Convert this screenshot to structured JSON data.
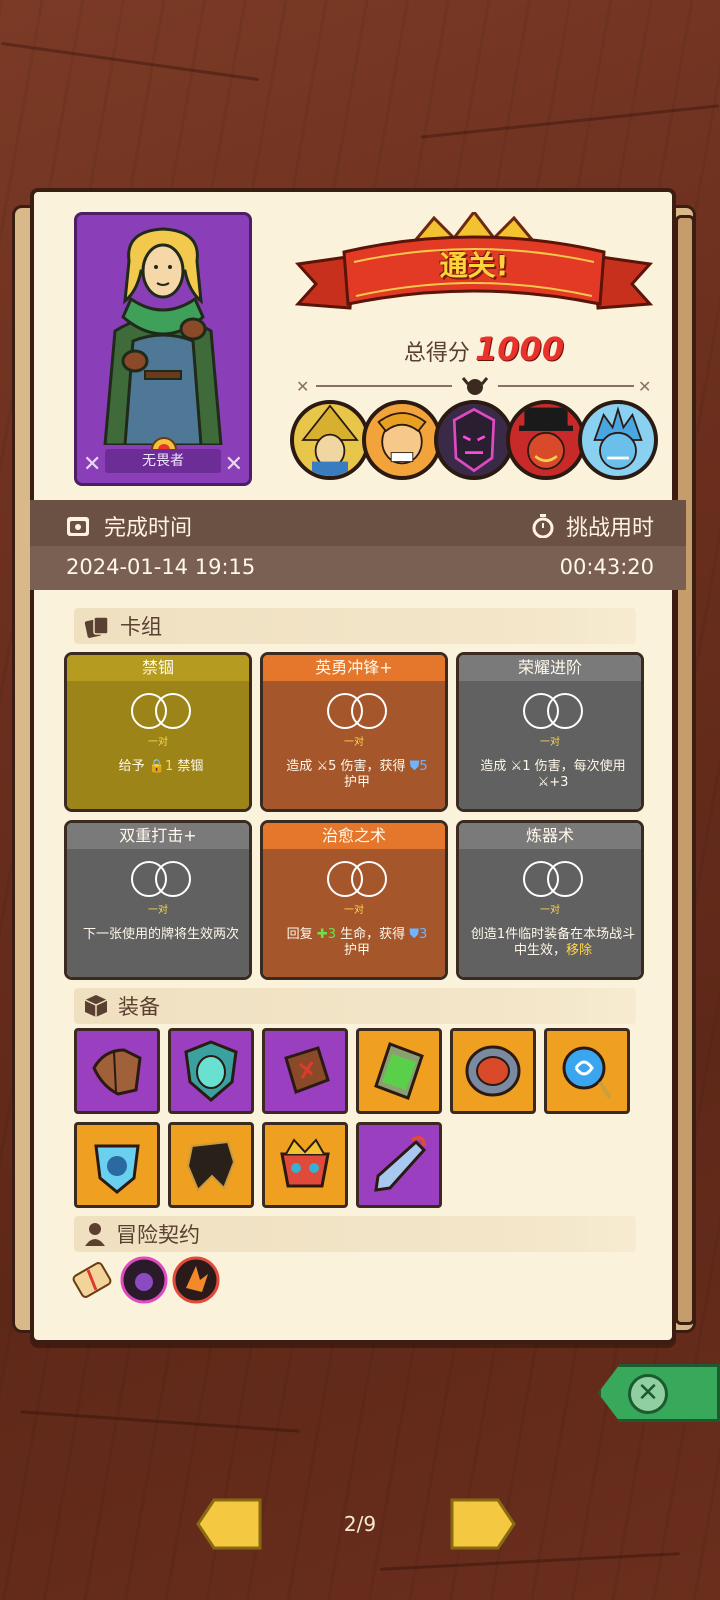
{
  "hero": {
    "name": "无畏者"
  },
  "result": {
    "banner": "通关!",
    "score_label": "总得分",
    "score_value": "1000"
  },
  "bosses": [
    "boss-1",
    "boss-2",
    "boss-3",
    "boss-4",
    "boss-5"
  ],
  "stats": {
    "complete_label": "完成时间",
    "challenge_label": "挑战用时",
    "complete_value": "2024-01-14 19:15",
    "challenge_value": "00:43:20"
  },
  "deck": {
    "title": "卡组",
    "pair_label": "一对",
    "cards": [
      {
        "name": "禁锢",
        "color": "yellow",
        "desc_a": "给予 ",
        "num_a": "1",
        "desc_b": " 禁锢"
      },
      {
        "name": "英勇冲锋+",
        "color": "orange",
        "desc_a": "造成 ",
        "num_a": "5",
        "desc_b": " 伤害，获得 ",
        "num_b": "5",
        "desc_c": "护甲"
      },
      {
        "name": "荣耀进阶",
        "color": "gray",
        "desc_a": "造成 ",
        "num_a": "1",
        "desc_b": " 伤害，每次使用",
        "num_b": "+3"
      },
      {
        "name": "双重打击+",
        "color": "gray",
        "desc_a": "下一张使用的牌将生效两次"
      },
      {
        "name": "治愈之术",
        "color": "orange",
        "desc_a": "回复 ",
        "num_a": "3",
        "desc_b": " 生命，获得 ",
        "num_b": "3",
        "desc_c": "护甲"
      },
      {
        "name": "炼器术",
        "color": "gray",
        "desc_a": "创造1件临时装备在本场战斗中生效，",
        "num_a": "移除"
      }
    ]
  },
  "equipment": {
    "title": "装备",
    "items": [
      "leather-armor",
      "spirit-mask-shield",
      "rune-gauntlet",
      "green-tablet",
      "fire-orb-plate",
      "water-rune-pendant",
      "ice-skull-shield",
      "dark-cloak",
      "tribal-helm",
      "ice-dagger"
    ]
  },
  "contract": {
    "title": "冒险契约",
    "items": [
      "scroll",
      "potion-orb",
      "flame-orb"
    ]
  },
  "pager": "2/9",
  "colors": {
    "accent_red": "#e8322a",
    "close_green": "#38a85a",
    "nav_yellow": "#f5c842"
  }
}
